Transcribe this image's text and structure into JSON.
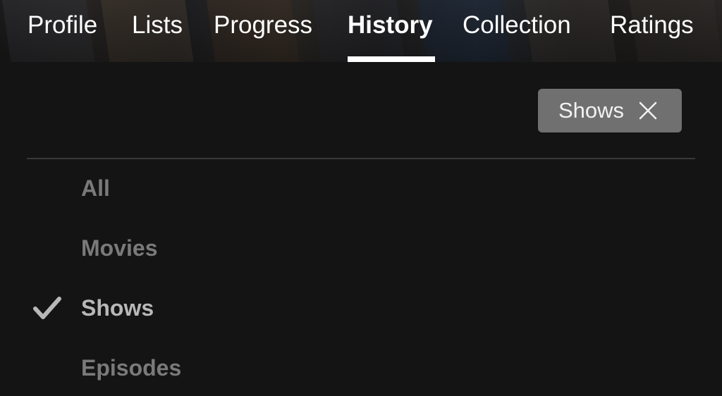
{
  "tabs": [
    {
      "label": "Profile",
      "active": false
    },
    {
      "label": "Lists",
      "active": false
    },
    {
      "label": "Progress",
      "active": false
    },
    {
      "label": "History",
      "active": true
    },
    {
      "label": "Collection",
      "active": false
    },
    {
      "label": "Ratings",
      "active": false
    }
  ],
  "filter_chip": {
    "label": "Shows",
    "icon": "close-icon"
  },
  "options": [
    {
      "label": "All",
      "selected": false
    },
    {
      "label": "Movies",
      "selected": false
    },
    {
      "label": "Shows",
      "selected": true
    },
    {
      "label": "Episodes",
      "selected": false
    }
  ],
  "colors": {
    "background": "#141414",
    "chip_background": "#707070",
    "option_text": "#7a7a7a",
    "selected_option_text": "#b8b8b8",
    "active_tab_underline": "#ffffff"
  }
}
